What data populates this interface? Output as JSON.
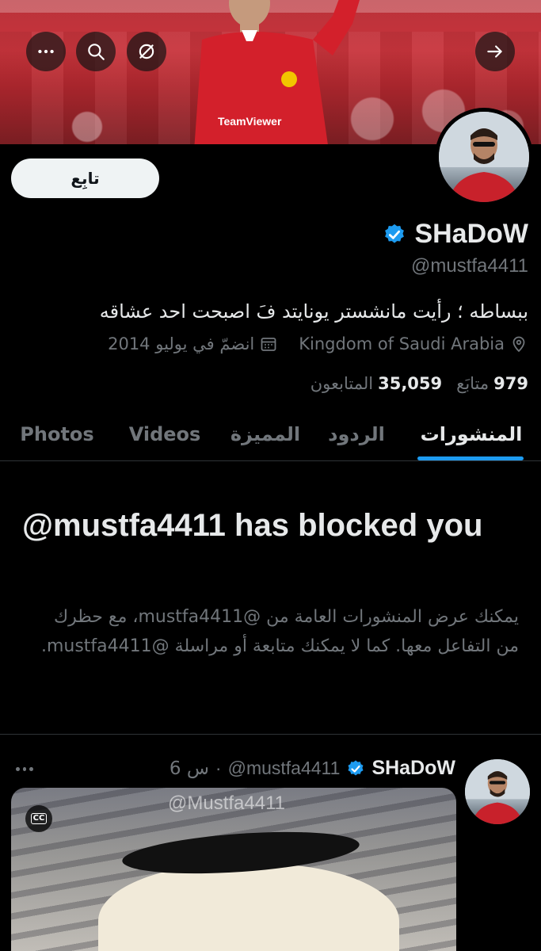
{
  "header": {
    "buttons": [
      "more",
      "search",
      "sync",
      "forward"
    ]
  },
  "profile": {
    "follow_label": "تابِع",
    "name": "SHaDoW",
    "handle": "@mustfa4411",
    "bio": "ببساطه ؛ رأيت مانشستر يونايتد فَ اصبحت احد عشاقه",
    "location": "Kingdom of Saudi Arabia",
    "joined": "انضمّ في يوليو 2014",
    "following_count": "979",
    "following_label": "متابَع",
    "followers_count": "35,059",
    "followers_label": "المتابعون"
  },
  "tabs": [
    {
      "label": "المنشورات",
      "active": true
    },
    {
      "label": "الردود",
      "active": false
    },
    {
      "label": "المميزة",
      "active": false
    },
    {
      "label": "Videos",
      "active": false
    },
    {
      "label": "Photos",
      "active": false
    }
  ],
  "blocked": {
    "title": "@mustfa4411 has blocked you",
    "description": "يمكنك عرض المنشورات العامة من @mustfa4411، مع حظرك من التفاعل معها. كما لا يمكنك متابعة أو مراسلة @mustfa4411."
  },
  "tweet": {
    "name": "SHaDoW",
    "handle": "@mustfa4411",
    "separator": "·",
    "time": "6 س",
    "watermark": "@Mustfa4411",
    "cc_label": "CC"
  },
  "colors": {
    "accent": "#1d9bf0",
    "background": "#000000",
    "muted_text": "#71767b"
  }
}
